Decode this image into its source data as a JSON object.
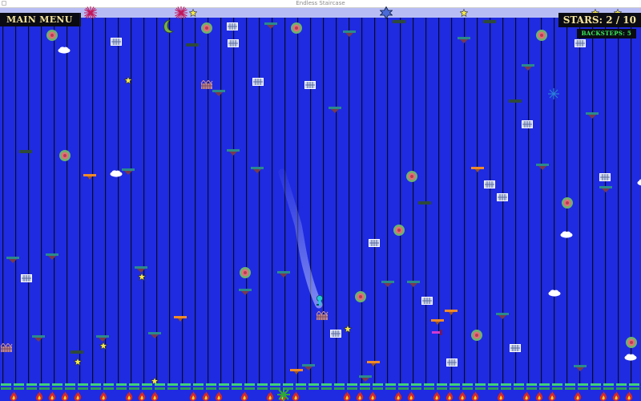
{
  "window": {
    "title": "Endless Staircase"
  },
  "hud": {
    "main_menu_label": "MAIN MENU",
    "stars_label": "STARS: 2 / 10",
    "backsteps_label": "BACKSTEPS: 5"
  },
  "colors": {
    "background": "#1f2be0",
    "strip": "#b7bdf4",
    "pole": "#0a0a2a",
    "hud_text": "#f3e39a",
    "backsteps_text": "#3cf05a"
  }
}
